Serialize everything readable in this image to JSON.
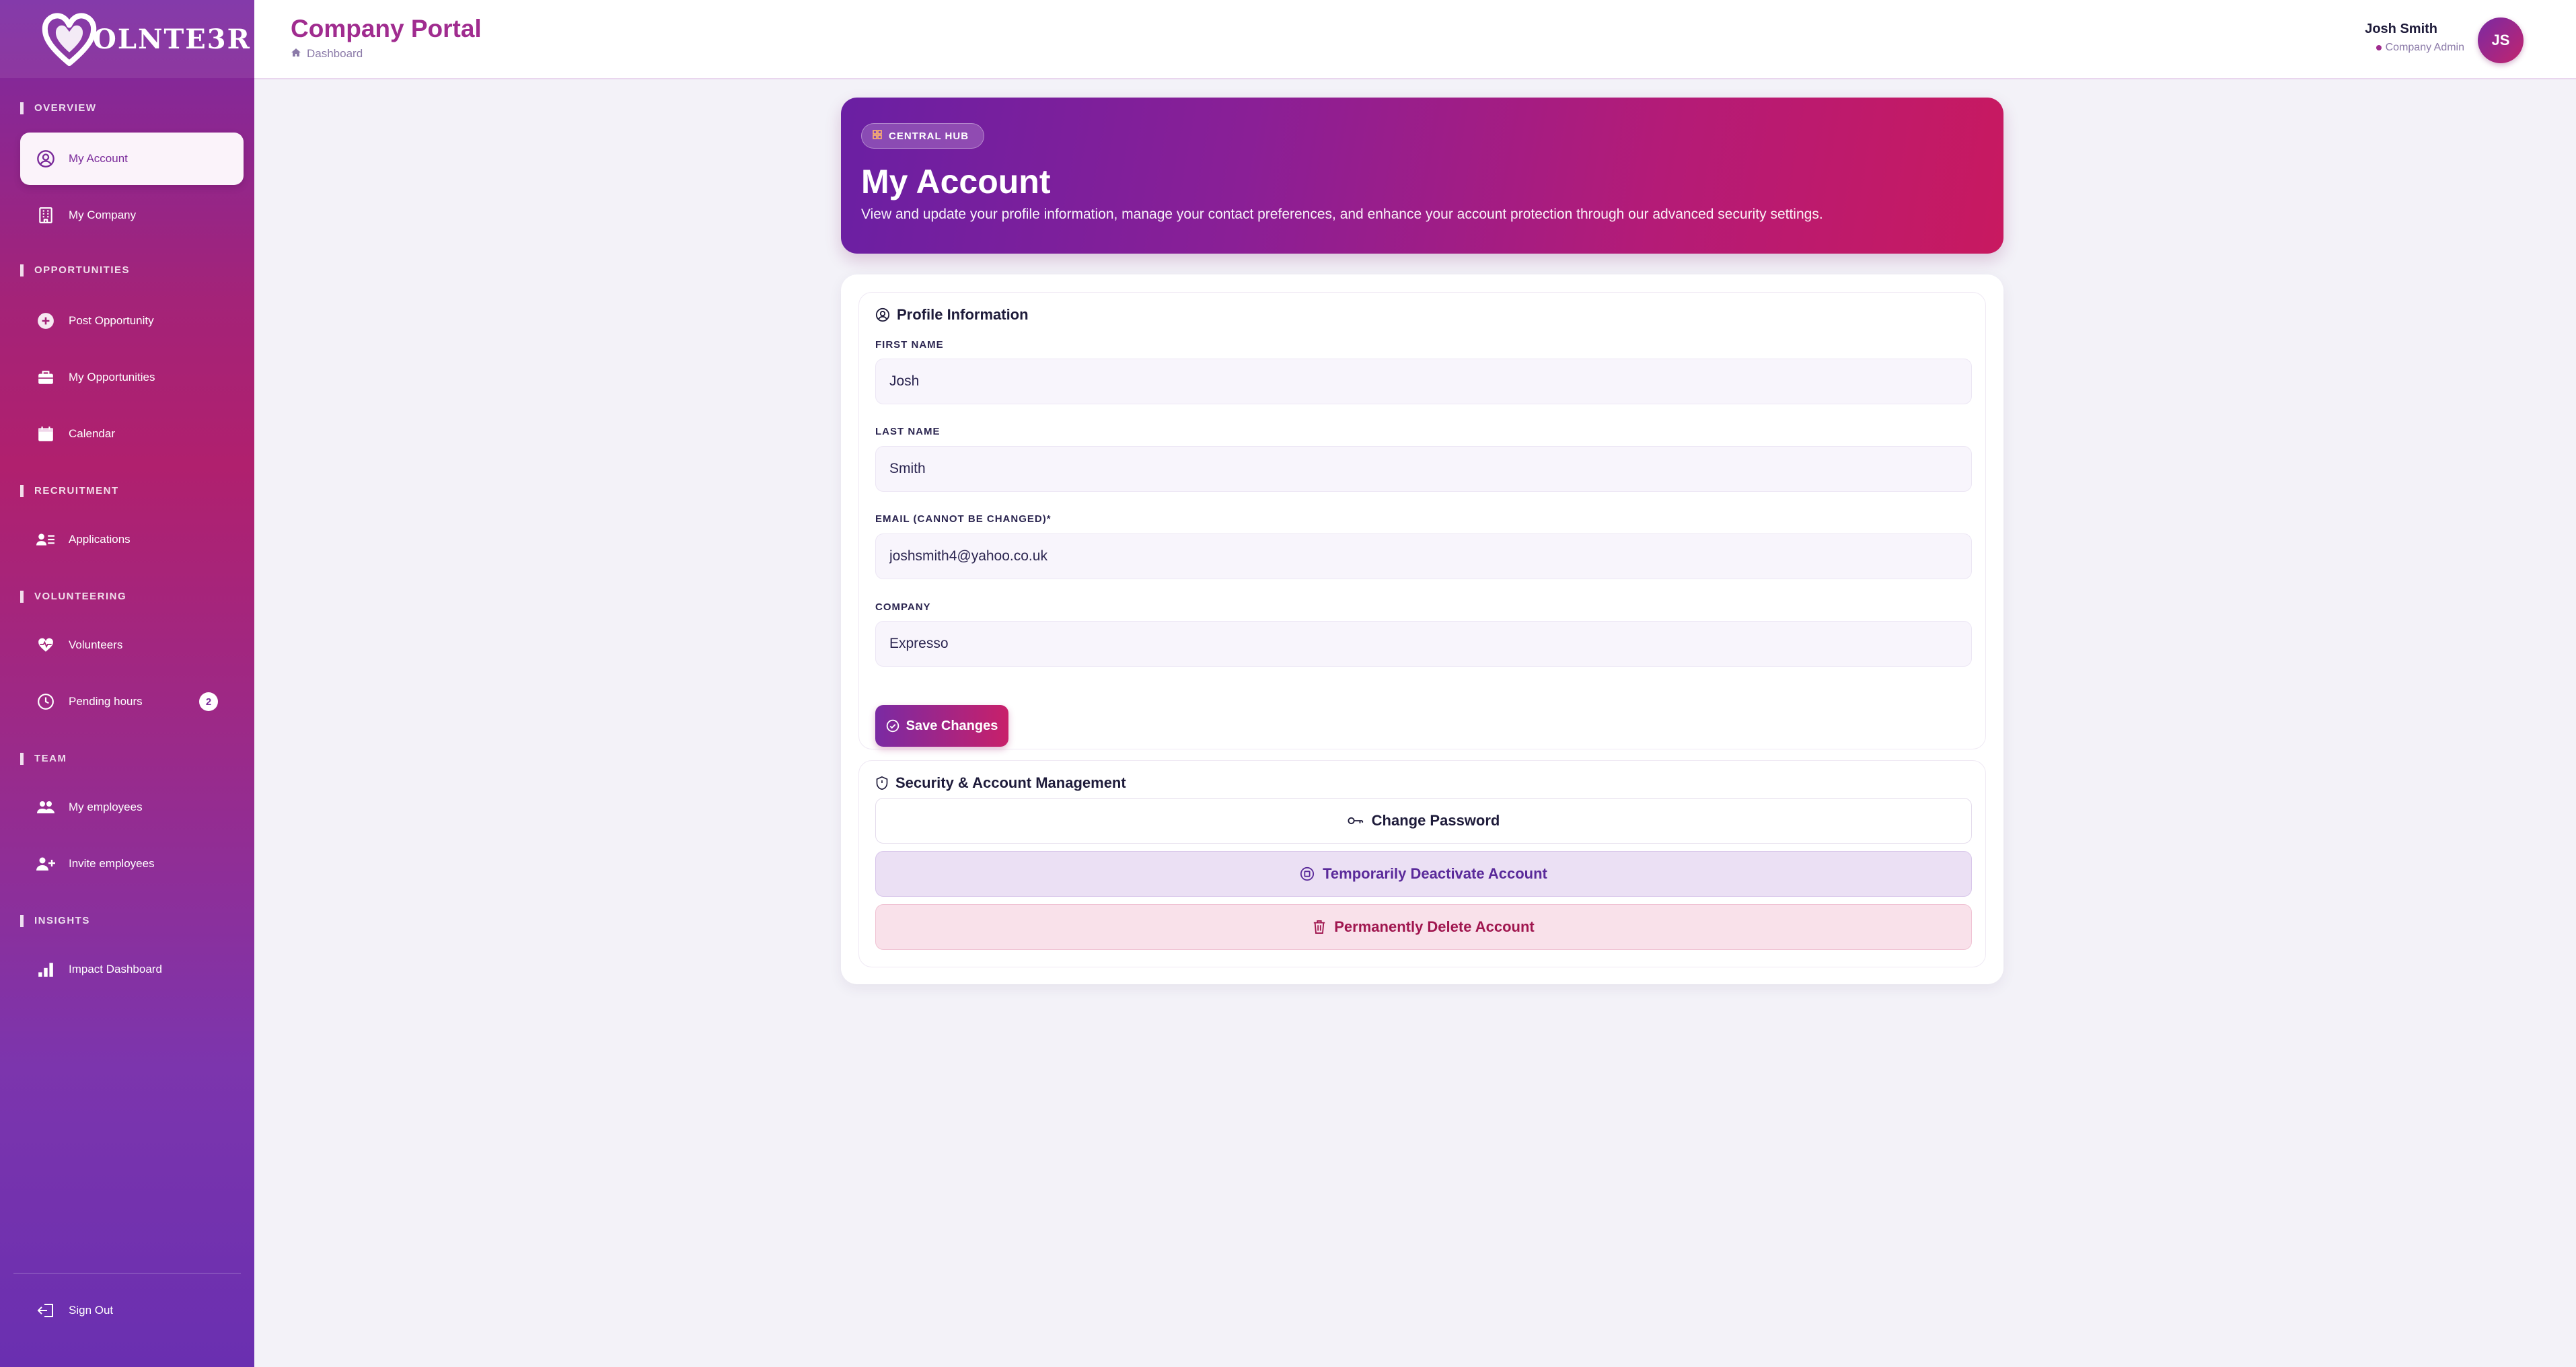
{
  "brand": {
    "logo_text": "OLNTE3R"
  },
  "sidebar": {
    "sections": [
      {
        "title": "OVERVIEW"
      },
      {
        "title": "OPPORTUNITIES"
      },
      {
        "title": "RECRUITMENT"
      },
      {
        "title": "VOLUNTEERING"
      },
      {
        "title": "TEAM"
      },
      {
        "title": "INSIGHTS"
      }
    ],
    "items": [
      {
        "label": "My Account",
        "icon": "user-circle-icon",
        "active": true
      },
      {
        "label": "My Company",
        "icon": "building-icon"
      },
      {
        "label": "Post Opportunity",
        "icon": "plus-circle-icon"
      },
      {
        "label": "My Opportunities",
        "icon": "briefcase-icon"
      },
      {
        "label": "Calendar",
        "icon": "calendar-icon"
      },
      {
        "label": "Applications",
        "icon": "user-list-icon"
      },
      {
        "label": "Volunteers",
        "icon": "heart-pulse-icon"
      },
      {
        "label": "Pending hours",
        "icon": "clock-icon",
        "badge": "2"
      },
      {
        "label": "My employees",
        "icon": "users-icon"
      },
      {
        "label": "Invite employees",
        "icon": "user-plus-icon"
      },
      {
        "label": "Impact Dashboard",
        "icon": "bar-chart-icon"
      }
    ],
    "sign_out": "Sign Out"
  },
  "header": {
    "title": "Company Portal",
    "breadcrumb": "Dashboard",
    "user_name": "Josh Smith",
    "user_role": "Company Admin",
    "avatar_initials": "JS"
  },
  "hero": {
    "badge": "CENTRAL HUB",
    "title": "My Account",
    "description": "View and update your profile information, manage your contact preferences, and enhance your account protection through our advanced security settings."
  },
  "profile": {
    "title": "Profile Information",
    "fields": [
      {
        "label": "FIRST NAME",
        "value": "Josh"
      },
      {
        "label": "LAST NAME",
        "value": "Smith"
      },
      {
        "label": "EMAIL (CANNOT BE CHANGED)*",
        "value": "joshsmith4@yahoo.co.uk"
      },
      {
        "label": "COMPANY",
        "value": "Expresso"
      }
    ],
    "save_label": "Save Changes"
  },
  "security": {
    "title": "Security & Account Management",
    "change_password": "Change Password",
    "deactivate": "Temporarily Deactivate Account",
    "delete": "Permanently Delete Account"
  },
  "colors": {
    "accent": "#a02c8f",
    "sidebar_top": "#7a2aa3",
    "sidebar_mid": "#b0206e",
    "danger": "#a0164f"
  }
}
